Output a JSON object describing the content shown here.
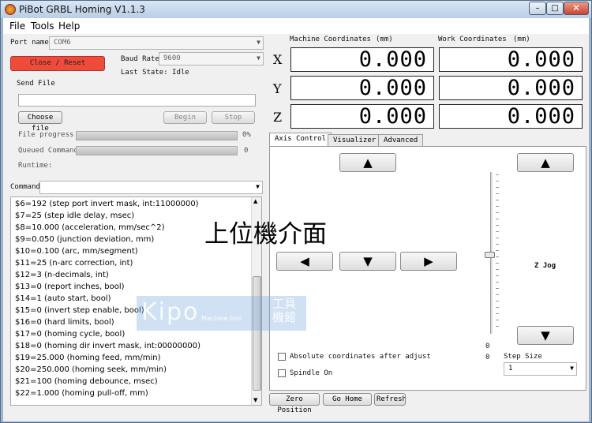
{
  "window": {
    "title": "PiBot GRBL Homing V1.1.3",
    "minimize": "–",
    "maximize": "□",
    "close": "✕"
  },
  "menu": [
    "File",
    "Tools",
    "Help"
  ],
  "connection": {
    "port_label": "Port name",
    "port_value": "COM6",
    "baud_label": "Baud Rate",
    "baud_value": "9600",
    "close_reset": "Close / Reset",
    "last_state": "Last State: Idle"
  },
  "send_file": {
    "title": "Send File",
    "choose": "Choose file",
    "begin": "Begin",
    "stop": "Stop",
    "file_progress_label": "File progress",
    "file_progress_value": "0%",
    "file_progress": 0,
    "queued_label": "Queued Commands",
    "queued_value": "0",
    "runtime_label": "Runtime:"
  },
  "command": {
    "label": "Command"
  },
  "console_lines": [
    "$6=192 (step port invert mask, int:11000000)",
    "$7=25 (step idle delay, msec)",
    "$8=10.000 (acceleration, mm/sec^2)",
    "$9=0.050 (junction deviation, mm)",
    "$10=0.100 (arc, mm/segment)",
    "$11=25 (n-arc correction, int)",
    "$12=3 (n-decimals, int)",
    "$13=0 (report inches, bool)",
    "$14=1 (auto start, bool)",
    "$15=0 (invert step enable, bool)",
    "$16=0 (hard limits, bool)",
    "$17=0 (homing cycle, bool)",
    "$18=0 (homing dir invert mask, int:00000000)",
    "$19=25.000 (homing feed, mm/min)",
    "$20=250.000 (homing seek, mm/min)",
    "$21=100 (homing debounce, msec)",
    "$22=1.000 (homing pull-off, mm)"
  ],
  "coords": {
    "machine_header": "Machine Coordinates",
    "work_header": "Work Coordinates",
    "unit": "(mm)",
    "axes": [
      "X",
      "Y",
      "Z"
    ],
    "machine": [
      "0.000",
      "0.000",
      "0.000"
    ],
    "work": [
      "0.000",
      "0.000",
      "0.000"
    ]
  },
  "tabs": [
    "Axis Control",
    "Visualizer",
    "Advanced"
  ],
  "axis_control": {
    "up": "▲",
    "left": "◀",
    "down": "▼",
    "right": "▶",
    "z_up": "▲",
    "z_down": "▼",
    "z_jog_label": "Z Jog",
    "slider_min": "0",
    "slider_max": "0",
    "absolute_label": "Absolute coordinates after adjust",
    "spindle_label": "Spindle On",
    "step_size_label": "Step Size",
    "step_size_value": "1",
    "zero_position": "Zero Position",
    "go_home": "Go Home",
    "refresh": "Refresh"
  },
  "overlay_text": "上位機介面",
  "watermark": {
    "brand": "Kipo",
    "sub": "Machine tool",
    "cjk": "工具機館"
  }
}
